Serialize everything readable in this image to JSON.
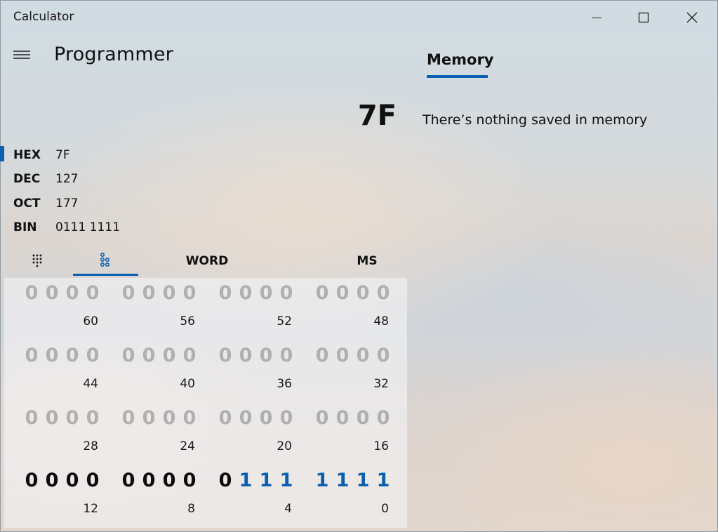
{
  "window": {
    "title": "Calculator"
  },
  "header": {
    "mode_title": "Programmer"
  },
  "display": {
    "value": "7F"
  },
  "memory": {
    "tab_label": "Memory",
    "empty_message": "There’s nothing saved in memory"
  },
  "radix": [
    {
      "name": "HEX",
      "value": "7F",
      "selected": true
    },
    {
      "name": "DEC",
      "value": "127",
      "selected": false
    },
    {
      "name": "OCT",
      "value": "177",
      "selected": false
    },
    {
      "name": "BIN",
      "value": "0111 1111",
      "selected": false
    }
  ],
  "keypad_tabs": {
    "full_keypad_icon": "keypad-grid-icon",
    "bit_toggle_icon": "bit-toggle-icon",
    "word_size": "WORD",
    "memory_store": "MS"
  },
  "bit_panel": {
    "rows": [
      {
        "groups": [
          {
            "bits": [
              "0",
              "0",
              "0",
              "0"
            ],
            "label": "60",
            "active": false
          },
          {
            "bits": [
              "0",
              "0",
              "0",
              "0"
            ],
            "label": "56",
            "active": false
          },
          {
            "bits": [
              "0",
              "0",
              "0",
              "0"
            ],
            "label": "52",
            "active": false
          },
          {
            "bits": [
              "0",
              "0",
              "0",
              "0"
            ],
            "label": "48",
            "active": false
          }
        ]
      },
      {
        "groups": [
          {
            "bits": [
              "0",
              "0",
              "0",
              "0"
            ],
            "label": "44",
            "active": false
          },
          {
            "bits": [
              "0",
              "0",
              "0",
              "0"
            ],
            "label": "40",
            "active": false
          },
          {
            "bits": [
              "0",
              "0",
              "0",
              "0"
            ],
            "label": "36",
            "active": false
          },
          {
            "bits": [
              "0",
              "0",
              "0",
              "0"
            ],
            "label": "32",
            "active": false
          }
        ]
      },
      {
        "groups": [
          {
            "bits": [
              "0",
              "0",
              "0",
              "0"
            ],
            "label": "28",
            "active": false
          },
          {
            "bits": [
              "0",
              "0",
              "0",
              "0"
            ],
            "label": "24",
            "active": false
          },
          {
            "bits": [
              "0",
              "0",
              "0",
              "0"
            ],
            "label": "20",
            "active": false
          },
          {
            "bits": [
              "0",
              "0",
              "0",
              "0"
            ],
            "label": "16",
            "active": false
          }
        ]
      },
      {
        "groups": [
          {
            "bits": [
              "0",
              "0",
              "0",
              "0"
            ],
            "label": "12",
            "active": true
          },
          {
            "bits": [
              "0",
              "0",
              "0",
              "0"
            ],
            "label": "8",
            "active": true
          },
          {
            "bits": [
              "0",
              "1",
              "1",
              "1"
            ],
            "label": "4",
            "active": true
          },
          {
            "bits": [
              "1",
              "1",
              "1",
              "1"
            ],
            "label": "0",
            "active": true
          }
        ]
      }
    ]
  },
  "colors": {
    "accent": "#0a5fb0",
    "inactive_bit": "#b0b0b0"
  }
}
